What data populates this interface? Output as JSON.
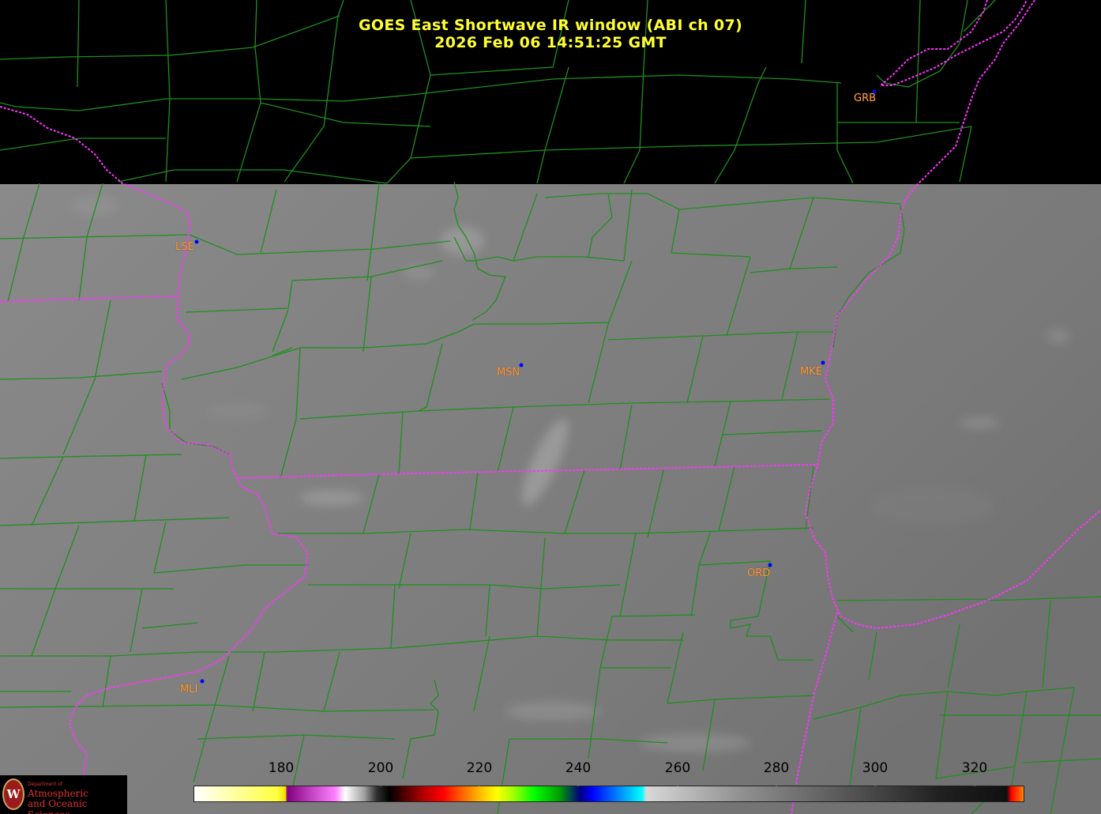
{
  "title": {
    "line1": "GOES East Shortwave IR window (ABI ch 07)",
    "line2": "2026 Feb 06  14:51:25 GMT"
  },
  "stations": [
    {
      "id": "GRB",
      "name": "GRB"
    },
    {
      "id": "LSE",
      "name": "LSE"
    },
    {
      "id": "MSN",
      "name": "MSN"
    },
    {
      "id": "MKE",
      "name": "MKE"
    },
    {
      "id": "ORD",
      "name": "ORD"
    },
    {
      "id": "MLI",
      "name": "MLI"
    }
  ],
  "colorbar": {
    "ticks": [
      "180",
      "200",
      "220",
      "240",
      "260",
      "280",
      "300",
      "320"
    ],
    "tick_values": [
      180,
      200,
      220,
      240,
      260,
      280,
      300,
      320
    ]
  },
  "logo": {
    "dept": "Department of",
    "line1": "Atmospheric",
    "line2": "and Oceanic Sciences",
    "seal": "W"
  },
  "colors": {
    "title": "#ffff33",
    "county_lines": "#1f8f1f",
    "state_lines": "#ff33ff",
    "station_dot": "#0000ff",
    "station_label": "#ff9a3c",
    "no_data": "#000000",
    "imagery_base": "#828282"
  }
}
